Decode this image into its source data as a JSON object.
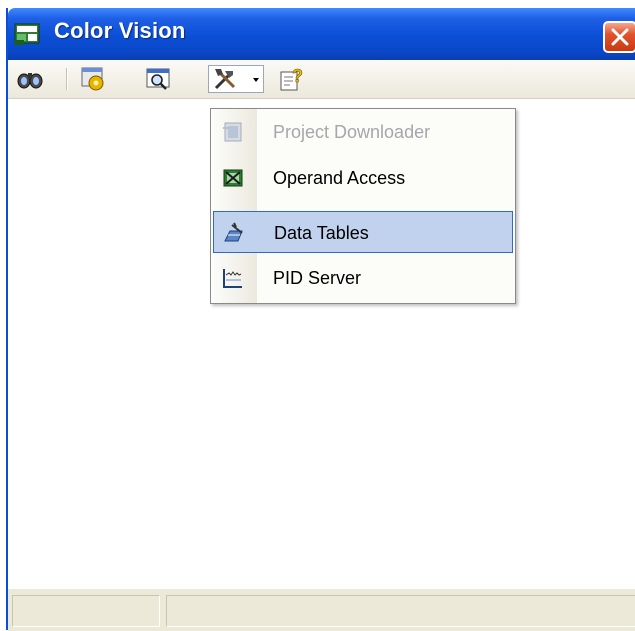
{
  "window": {
    "title": "Color Vision",
    "title_bar_color": "#0a4fd8",
    "close_button_color": "#e2542e"
  },
  "toolbar": {
    "buttons": [
      {
        "name": "binoculars",
        "icon": "binoculars-icon",
        "has_dropdown": false
      },
      {
        "name": "settings",
        "icon": "gear-window-icon",
        "has_dropdown": true
      },
      {
        "name": "view",
        "icon": "magnifier-window-icon",
        "has_dropdown": true
      },
      {
        "name": "tools",
        "icon": "tools-icon",
        "has_dropdown": true,
        "pressed": true
      },
      {
        "name": "help",
        "icon": "help-icon",
        "has_dropdown": true
      }
    ]
  },
  "menu": {
    "items": [
      {
        "label": "Project Downloader",
        "icon": "downloader-icon",
        "enabled": false,
        "selected": false
      },
      {
        "label": "Operand Access",
        "icon": "operand-access-icon",
        "enabled": true,
        "selected": false
      },
      {
        "label": "Data Tables",
        "icon": "data-tables-icon",
        "enabled": true,
        "selected": true
      },
      {
        "label": "PID Server",
        "icon": "pid-server-icon",
        "enabled": true,
        "selected": false
      }
    ],
    "selection_color": "#c1d2ee"
  }
}
